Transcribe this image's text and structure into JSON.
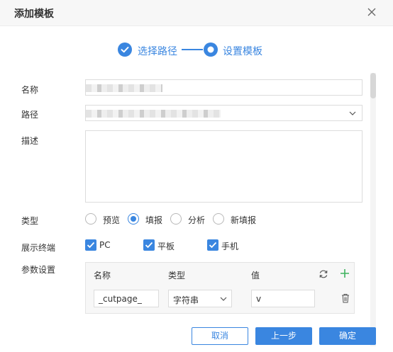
{
  "dialog": {
    "title": "添加模板"
  },
  "steps": [
    {
      "label": "选择路径",
      "state": "done"
    },
    {
      "label": "设置模板",
      "state": "active"
    }
  ],
  "form": {
    "name_label": "名称",
    "path_label": "路径",
    "desc_label": "描述",
    "type_label": "类型",
    "type_options": [
      "预览",
      "填报",
      "分析",
      "新填报"
    ],
    "type_selected": "填报",
    "terminal_label": "展示终端",
    "terminals": [
      {
        "label": "PC",
        "checked": true
      },
      {
        "label": "平板",
        "checked": true
      },
      {
        "label": "手机",
        "checked": true
      }
    ],
    "params_label": "参数设置"
  },
  "params": {
    "headers": [
      "名称",
      "类型",
      "值"
    ],
    "rows": [
      {
        "name": "_cutpage_",
        "type": "字符串",
        "value": "v"
      }
    ]
  },
  "buttons": {
    "cancel": "取消",
    "prev": "上一步",
    "confirm": "确定"
  },
  "colors": {
    "accent": "#3a86e0",
    "add_icon": "#3fb35f"
  }
}
